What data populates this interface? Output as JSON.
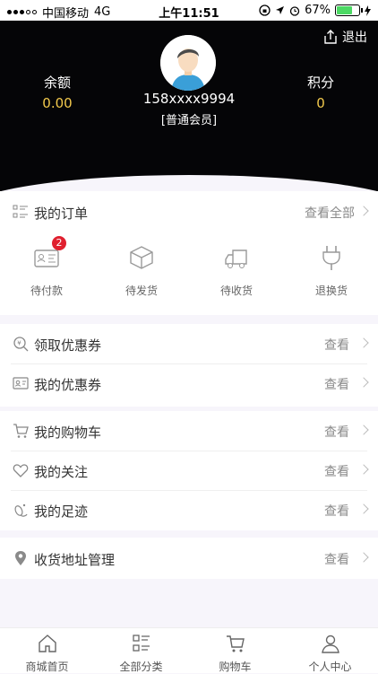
{
  "status_bar": {
    "carrier": "中国移动",
    "network": "4G",
    "time": "上午11:51",
    "battery": "67%",
    "battery_level": 0.67
  },
  "header": {
    "logout_label": "退出",
    "balance_label": "余额",
    "balance_value": "0.00",
    "points_label": "积分",
    "points_value": "0",
    "phone": "158xxxx9994",
    "member_level": "[普通会员]"
  },
  "orders": {
    "title": "我的订单",
    "view_all": "查看全部",
    "items": [
      {
        "label": "待付款",
        "icon": "pending-payment-icon",
        "badge": "2"
      },
      {
        "label": "待发货",
        "icon": "box-icon"
      },
      {
        "label": "待收货",
        "icon": "truck-icon"
      },
      {
        "label": "退换货",
        "icon": "plug-icon"
      }
    ]
  },
  "menu": [
    {
      "label": "领取优惠券",
      "action": "查看",
      "icon": "coupon-search-icon"
    },
    {
      "label": "我的优惠券",
      "action": "查看",
      "icon": "coupon-card-icon"
    },
    {
      "label": "我的购物车",
      "action": "查看",
      "icon": "cart-icon"
    },
    {
      "label": "我的关注",
      "action": "查看",
      "icon": "heart-icon"
    },
    {
      "label": "我的足迹",
      "action": "查看",
      "icon": "footprint-icon"
    },
    {
      "label": "收货地址管理",
      "action": "查看",
      "icon": "location-pin-icon"
    }
  ],
  "tabbar": [
    {
      "label": "商城首页",
      "icon": "home-icon"
    },
    {
      "label": "全部分类",
      "icon": "category-icon"
    },
    {
      "label": "购物车",
      "icon": "cart-icon"
    },
    {
      "label": "个人中心",
      "icon": "profile-icon"
    }
  ]
}
